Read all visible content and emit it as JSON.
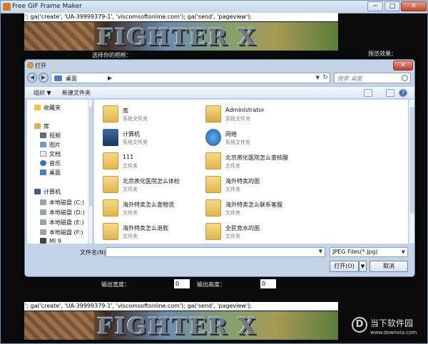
{
  "app": {
    "title": "Free GIF Frame Maker",
    "controls": {
      "minimize": "─",
      "maximize": "□",
      "close": "✕"
    },
    "code_line": "'; ga('create', 'UA-39999379-1', 'viscomsoftonline.com'); ga('send', 'pageview');",
    "banner_text": "FIGHTER X",
    "background": {
      "select_frame_label": "选择你的相框：",
      "preview_label": "预览效果：",
      "output_width_label": "输出宽度：",
      "output_width_value": "0",
      "output_height_label": "输出高度：",
      "output_height_value": "0"
    }
  },
  "dialog": {
    "title": "打开",
    "close": "✕",
    "back": "◀",
    "forward": "▶",
    "address": {
      "location": "桌面",
      "arrow": "▶",
      "dropdown": "▼",
      "refresh": "↻"
    },
    "search": {
      "placeholder": "搜索 桌面"
    },
    "toolbar": {
      "organize": "组织 ▼",
      "new_folder": "新建文件夹",
      "help": "?"
    },
    "nav": {
      "favorites": "收藏夹",
      "library": "库",
      "library_items": [
        "视频",
        "图片",
        "文档",
        "音乐"
      ],
      "desktop": "桌面",
      "computer": "计算机",
      "drives": [
        "本地磁盘 (C:)",
        "本地磁盘 (D:)",
        "本地磁盘 (E:)",
        "本地磁盘 (F:)",
        "MI 9"
      ]
    },
    "files": [
      {
        "name": "库",
        "type": "系统文件夹",
        "icon": "library-icon"
      },
      {
        "name": "Administrator",
        "type": "系统文件夹",
        "icon": "user-folder-icon"
      },
      {
        "name": "计算机",
        "type": "系统文件夹",
        "icon": "computer-icon"
      },
      {
        "name": "网络",
        "type": "系统文件夹",
        "icon": "network-icon"
      },
      {
        "name": "111",
        "type": "文件夹",
        "icon": "folder-icon"
      },
      {
        "name": "北京燕化医院怎么查核酸",
        "type": "文件夹",
        "icon": "folder-icon"
      },
      {
        "name": "北京燕化医院怎么体检",
        "type": "文件夹",
        "icon": "folder-icon"
      },
      {
        "name": "海外特卖的图",
        "type": "文件夹",
        "icon": "folder-icon"
      },
      {
        "name": "海外特卖怎么查物流",
        "type": "文件夹",
        "icon": "folder-icon"
      },
      {
        "name": "海外特卖怎么联系客服",
        "type": "文件夹",
        "icon": "folder-icon"
      },
      {
        "name": "海外特卖怎么退款",
        "type": "文件夹",
        "icon": "folder-icon"
      },
      {
        "name": "全民竞水的图",
        "type": "文件夹",
        "icon": "folder-icon"
      }
    ],
    "filename_label": "文件名(N):",
    "filename_value": "",
    "filetype_value": "JPEG Files(*.jpg)",
    "open_button": "打开(O)",
    "cancel_button": "取消",
    "dropdown_arrow": "▼"
  },
  "watermark": {
    "name": "当下软件园",
    "url": "www.downxia.com",
    "logo_glyph": "D"
  }
}
